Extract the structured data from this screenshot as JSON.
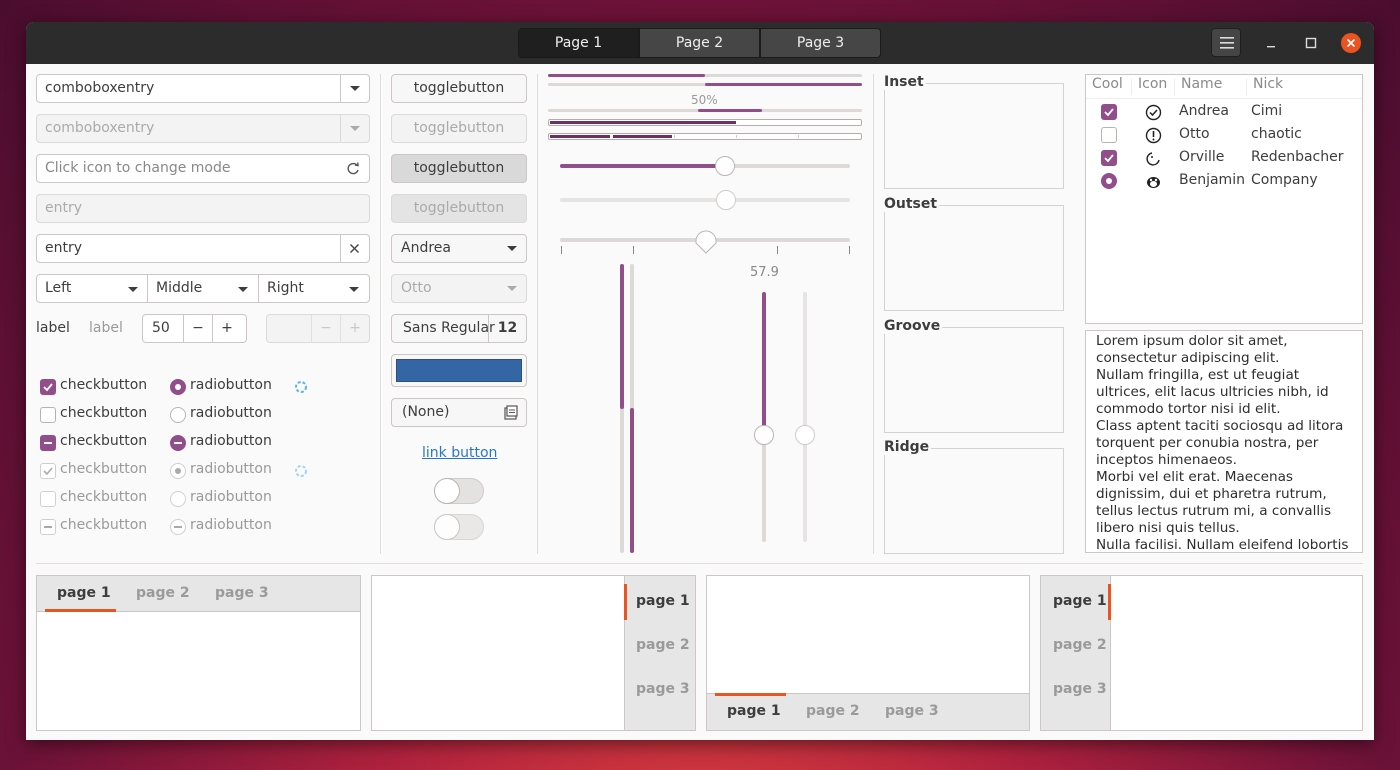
{
  "window": {
    "stack_tabs": [
      "Page 1",
      "Page 2",
      "Page 3"
    ],
    "menu_icon": "hamburger-menu-icon",
    "controls": [
      "minimize-icon",
      "maximize-icon",
      "close-icon"
    ],
    "accent": "#924d8b",
    "close_color": "#e95420"
  },
  "left": {
    "combo1": "comboboxentry",
    "combo2": "comboboxentry",
    "mode_entry_placeholder": "Click icon to change mode",
    "entry_disabled": "entry",
    "entry_clear": "entry",
    "combos": [
      "Left",
      "Middle",
      "Right"
    ],
    "label1": "label",
    "label2": "label",
    "spin_value": "50",
    "spin_minus": "−",
    "spin_plus": "+",
    "checks": [
      "checkbutton",
      "checkbutton",
      "checkbutton",
      "checkbutton",
      "checkbutton",
      "checkbutton"
    ],
    "radios": [
      "radiobutton",
      "radiobutton",
      "radiobutton",
      "radiobutton",
      "radiobutton",
      "radiobutton"
    ]
  },
  "middle": {
    "toggles": [
      "togglebutton",
      "togglebutton",
      "togglebutton",
      "togglebutton"
    ],
    "combo_andrea": "Andrea",
    "combo_otto": "Otto",
    "font_name": "Sans Regular",
    "font_size": "12",
    "color_button": "#3465a4",
    "file_chooser": "(None)",
    "link": "link button"
  },
  "sliders": {
    "progress_label": "50%",
    "scale_value": "57.9",
    "progress_top": 0.5,
    "scale1": 0.57,
    "scale3": 0.5
  },
  "frames": [
    "Inset",
    "Outset",
    "Groove",
    "Ridge"
  ],
  "tree": {
    "headers": [
      "Cool",
      "Icon",
      "Name",
      "Nick"
    ],
    "rows": [
      {
        "cool": "checked",
        "icon": "check-circle-icon",
        "name": "Andrea",
        "nick": "Cimi"
      },
      {
        "cool": "unchecked",
        "icon": "warning-circle-icon",
        "name": "Otto",
        "nick": "chaotic"
      },
      {
        "cool": "checked",
        "icon": "moon-face-icon",
        "name": "Orville",
        "nick": "Redenbacher"
      },
      {
        "cool": "radio-on",
        "icon": "penguin-icon",
        "name": "Benjamin",
        "nick": "Company"
      }
    ]
  },
  "text_view": [
    "Lorem ipsum dolor sit amet,",
    "consectetur adipiscing elit.",
    "Nullam fringilla, est ut feugiat",
    "ultrices, elit lacus ultricies nibh, id",
    "commodo tortor nisi id elit.",
    "Class aptent taciti sociosqu ad litora",
    "torquent per conubia nostra, per",
    "inceptos himenaeos.",
    "Morbi vel elit erat. Maecenas",
    "dignissim, dui et pharetra rutrum,",
    "tellus lectus rutrum mi, a convallis",
    "libero nisi quis tellus.",
    "Nulla facilisi. Nullam eleifend lobortis"
  ],
  "notebooks": {
    "top": [
      "page 1",
      "page 2",
      "page 3"
    ],
    "right": [
      "page 1",
      "page 2",
      "page 3"
    ],
    "bottom": [
      "page 1",
      "page 2",
      "page 3"
    ],
    "left": [
      "page 1",
      "page 2",
      "page 3"
    ]
  }
}
